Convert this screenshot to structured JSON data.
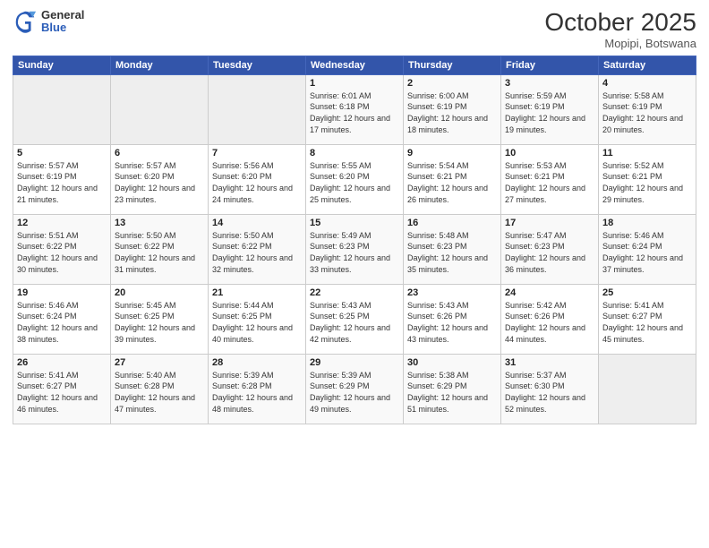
{
  "header": {
    "logo": {
      "general": "General",
      "blue": "Blue"
    },
    "title": "October 2025",
    "subtitle": "Mopipi, Botswana"
  },
  "weekdays": [
    "Sunday",
    "Monday",
    "Tuesday",
    "Wednesday",
    "Thursday",
    "Friday",
    "Saturday"
  ],
  "weeks": [
    [
      {
        "day": "",
        "empty": true
      },
      {
        "day": "",
        "empty": true
      },
      {
        "day": "",
        "empty": true
      },
      {
        "day": "1",
        "sunrise": "Sunrise: 6:01 AM",
        "sunset": "Sunset: 6:18 PM",
        "daylight": "Daylight: 12 hours and 17 minutes."
      },
      {
        "day": "2",
        "sunrise": "Sunrise: 6:00 AM",
        "sunset": "Sunset: 6:19 PM",
        "daylight": "Daylight: 12 hours and 18 minutes."
      },
      {
        "day": "3",
        "sunrise": "Sunrise: 5:59 AM",
        "sunset": "Sunset: 6:19 PM",
        "daylight": "Daylight: 12 hours and 19 minutes."
      },
      {
        "day": "4",
        "sunrise": "Sunrise: 5:58 AM",
        "sunset": "Sunset: 6:19 PM",
        "daylight": "Daylight: 12 hours and 20 minutes."
      }
    ],
    [
      {
        "day": "5",
        "sunrise": "Sunrise: 5:57 AM",
        "sunset": "Sunset: 6:19 PM",
        "daylight": "Daylight: 12 hours and 21 minutes."
      },
      {
        "day": "6",
        "sunrise": "Sunrise: 5:57 AM",
        "sunset": "Sunset: 6:20 PM",
        "daylight": "Daylight: 12 hours and 23 minutes."
      },
      {
        "day": "7",
        "sunrise": "Sunrise: 5:56 AM",
        "sunset": "Sunset: 6:20 PM",
        "daylight": "Daylight: 12 hours and 24 minutes."
      },
      {
        "day": "8",
        "sunrise": "Sunrise: 5:55 AM",
        "sunset": "Sunset: 6:20 PM",
        "daylight": "Daylight: 12 hours and 25 minutes."
      },
      {
        "day": "9",
        "sunrise": "Sunrise: 5:54 AM",
        "sunset": "Sunset: 6:21 PM",
        "daylight": "Daylight: 12 hours and 26 minutes."
      },
      {
        "day": "10",
        "sunrise": "Sunrise: 5:53 AM",
        "sunset": "Sunset: 6:21 PM",
        "daylight": "Daylight: 12 hours and 27 minutes."
      },
      {
        "day": "11",
        "sunrise": "Sunrise: 5:52 AM",
        "sunset": "Sunset: 6:21 PM",
        "daylight": "Daylight: 12 hours and 29 minutes."
      }
    ],
    [
      {
        "day": "12",
        "sunrise": "Sunrise: 5:51 AM",
        "sunset": "Sunset: 6:22 PM",
        "daylight": "Daylight: 12 hours and 30 minutes."
      },
      {
        "day": "13",
        "sunrise": "Sunrise: 5:50 AM",
        "sunset": "Sunset: 6:22 PM",
        "daylight": "Daylight: 12 hours and 31 minutes."
      },
      {
        "day": "14",
        "sunrise": "Sunrise: 5:50 AM",
        "sunset": "Sunset: 6:22 PM",
        "daylight": "Daylight: 12 hours and 32 minutes."
      },
      {
        "day": "15",
        "sunrise": "Sunrise: 5:49 AM",
        "sunset": "Sunset: 6:23 PM",
        "daylight": "Daylight: 12 hours and 33 minutes."
      },
      {
        "day": "16",
        "sunrise": "Sunrise: 5:48 AM",
        "sunset": "Sunset: 6:23 PM",
        "daylight": "Daylight: 12 hours and 35 minutes."
      },
      {
        "day": "17",
        "sunrise": "Sunrise: 5:47 AM",
        "sunset": "Sunset: 6:23 PM",
        "daylight": "Daylight: 12 hours and 36 minutes."
      },
      {
        "day": "18",
        "sunrise": "Sunrise: 5:46 AM",
        "sunset": "Sunset: 6:24 PM",
        "daylight": "Daylight: 12 hours and 37 minutes."
      }
    ],
    [
      {
        "day": "19",
        "sunrise": "Sunrise: 5:46 AM",
        "sunset": "Sunset: 6:24 PM",
        "daylight": "Daylight: 12 hours and 38 minutes."
      },
      {
        "day": "20",
        "sunrise": "Sunrise: 5:45 AM",
        "sunset": "Sunset: 6:25 PM",
        "daylight": "Daylight: 12 hours and 39 minutes."
      },
      {
        "day": "21",
        "sunrise": "Sunrise: 5:44 AM",
        "sunset": "Sunset: 6:25 PM",
        "daylight": "Daylight: 12 hours and 40 minutes."
      },
      {
        "day": "22",
        "sunrise": "Sunrise: 5:43 AM",
        "sunset": "Sunset: 6:25 PM",
        "daylight": "Daylight: 12 hours and 42 minutes."
      },
      {
        "day": "23",
        "sunrise": "Sunrise: 5:43 AM",
        "sunset": "Sunset: 6:26 PM",
        "daylight": "Daylight: 12 hours and 43 minutes."
      },
      {
        "day": "24",
        "sunrise": "Sunrise: 5:42 AM",
        "sunset": "Sunset: 6:26 PM",
        "daylight": "Daylight: 12 hours and 44 minutes."
      },
      {
        "day": "25",
        "sunrise": "Sunrise: 5:41 AM",
        "sunset": "Sunset: 6:27 PM",
        "daylight": "Daylight: 12 hours and 45 minutes."
      }
    ],
    [
      {
        "day": "26",
        "sunrise": "Sunrise: 5:41 AM",
        "sunset": "Sunset: 6:27 PM",
        "daylight": "Daylight: 12 hours and 46 minutes."
      },
      {
        "day": "27",
        "sunrise": "Sunrise: 5:40 AM",
        "sunset": "Sunset: 6:28 PM",
        "daylight": "Daylight: 12 hours and 47 minutes."
      },
      {
        "day": "28",
        "sunrise": "Sunrise: 5:39 AM",
        "sunset": "Sunset: 6:28 PM",
        "daylight": "Daylight: 12 hours and 48 minutes."
      },
      {
        "day": "29",
        "sunrise": "Sunrise: 5:39 AM",
        "sunset": "Sunset: 6:29 PM",
        "daylight": "Daylight: 12 hours and 49 minutes."
      },
      {
        "day": "30",
        "sunrise": "Sunrise: 5:38 AM",
        "sunset": "Sunset: 6:29 PM",
        "daylight": "Daylight: 12 hours and 51 minutes."
      },
      {
        "day": "31",
        "sunrise": "Sunrise: 5:37 AM",
        "sunset": "Sunset: 6:30 PM",
        "daylight": "Daylight: 12 hours and 52 minutes."
      },
      {
        "day": "",
        "empty": true
      }
    ]
  ]
}
